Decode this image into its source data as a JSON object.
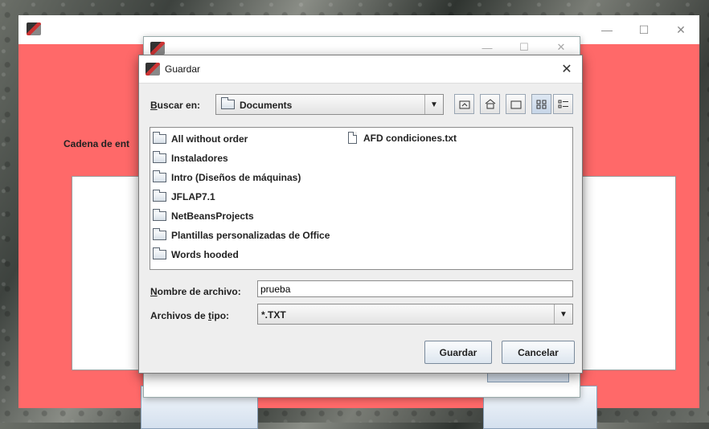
{
  "main_window": {
    "label_cadena": "Cadena de ent",
    "controls": {
      "minimize": "—",
      "maximize": "☐",
      "close": "✕"
    }
  },
  "secondary_window": {
    "controls": {
      "minimize": "—",
      "maximize": "☐",
      "close": "✕"
    }
  },
  "dialog": {
    "title": "Guardar",
    "close": "✕",
    "look_in": {
      "label_prefix": "B",
      "label_rest": "uscar en:",
      "value": "Documents"
    },
    "toolbar": {
      "up_icon": "up-folder-icon",
      "home_icon": "home-icon",
      "new_folder_icon": "new-folder-icon",
      "list_view_icon": "list-view-icon",
      "details_view_icon": "details-view-icon"
    },
    "files": [
      {
        "name": "All without order",
        "type": "folder"
      },
      {
        "name": "Instaladores",
        "type": "folder"
      },
      {
        "name": "Intro (Diseños de máquinas)",
        "type": "folder"
      },
      {
        "name": "JFLAP7.1",
        "type": "folder"
      },
      {
        "name": "NetBeansProjects",
        "type": "folder"
      },
      {
        "name": "Plantillas personalizadas de Office",
        "type": "folder"
      },
      {
        "name": "Words hooded",
        "type": "folder"
      },
      {
        "name": "AFD condiciones.txt",
        "type": "file"
      }
    ],
    "file_name": {
      "label_prefix": "N",
      "label_rest": "ombre de archivo:",
      "value": "prueba"
    },
    "file_type": {
      "label_pre": "Archivos de ",
      "label_ul": "t",
      "label_post": "ipo:",
      "value": "*.TXT"
    },
    "buttons": {
      "save": "Guardar",
      "cancel": "Cancelar"
    }
  }
}
